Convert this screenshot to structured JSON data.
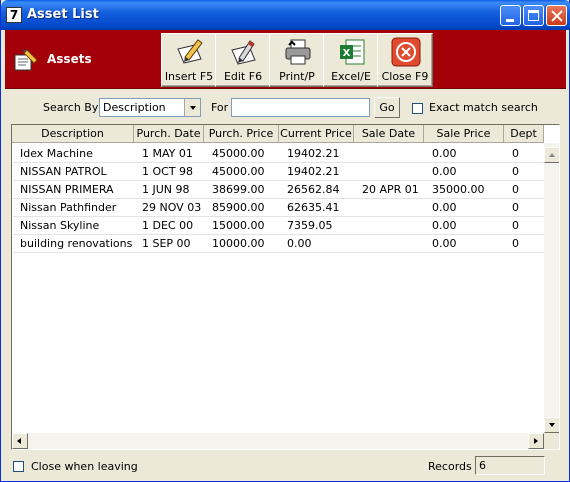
{
  "window": {
    "title": "Asset List",
    "app_icon_text": "7"
  },
  "toolbar": {
    "brand_label": "Assets",
    "buttons": [
      {
        "label": "Insert F5",
        "icon": "pencil-paper-icon"
      },
      {
        "label": "Edit F6",
        "icon": "edit-pencil-icon"
      },
      {
        "label": "Print/P",
        "icon": "printer-icon"
      },
      {
        "label": "Excel/E",
        "icon": "excel-icon"
      },
      {
        "label": "Close F9",
        "icon": "close-circle-icon"
      }
    ]
  },
  "search": {
    "by_label": "Search By",
    "by_value": "Description",
    "for_label": "For",
    "for_value": "",
    "go_label": "Go",
    "exact_label": "Exact match search",
    "exact_checked": false
  },
  "table": {
    "columns": [
      "Description",
      "Purch. Date",
      "Purch. Price",
      "Current Price",
      "Sale Date",
      "Sale Price",
      "Dept"
    ],
    "rows": [
      [
        "Idex Machine",
        "1 MAY 01",
        "45000.00",
        "19402.21",
        "",
        "0.00",
        "0"
      ],
      [
        "NISSAN PATROL",
        "1 OCT 98",
        "45000.00",
        "19402.21",
        "",
        "0.00",
        "0"
      ],
      [
        "NISSAN PRIMERA",
        "1 JUN 98",
        "38699.00",
        "26562.84",
        "20 APR 01",
        "35000.00",
        "0"
      ],
      [
        "Nissan Pathfinder",
        "29 NOV 03",
        "85900.00",
        "62635.41",
        "",
        "0.00",
        "0"
      ],
      [
        "Nissan Skyline",
        "1 DEC 00",
        "15000.00",
        "7359.05",
        "",
        "0.00",
        "0"
      ],
      [
        "building renovations",
        "1 SEP 00",
        "10000.00",
        "0.00",
        "",
        "0.00",
        "0"
      ]
    ]
  },
  "footer": {
    "close_when_leaving_label": "Close when leaving",
    "close_when_leaving_checked": false,
    "records_label": "Records",
    "records_value": "6"
  },
  "colors": {
    "toolbar_band": "#a4000a",
    "titlebar": "#0a5ee8",
    "window_bg": "#ece9d8"
  }
}
